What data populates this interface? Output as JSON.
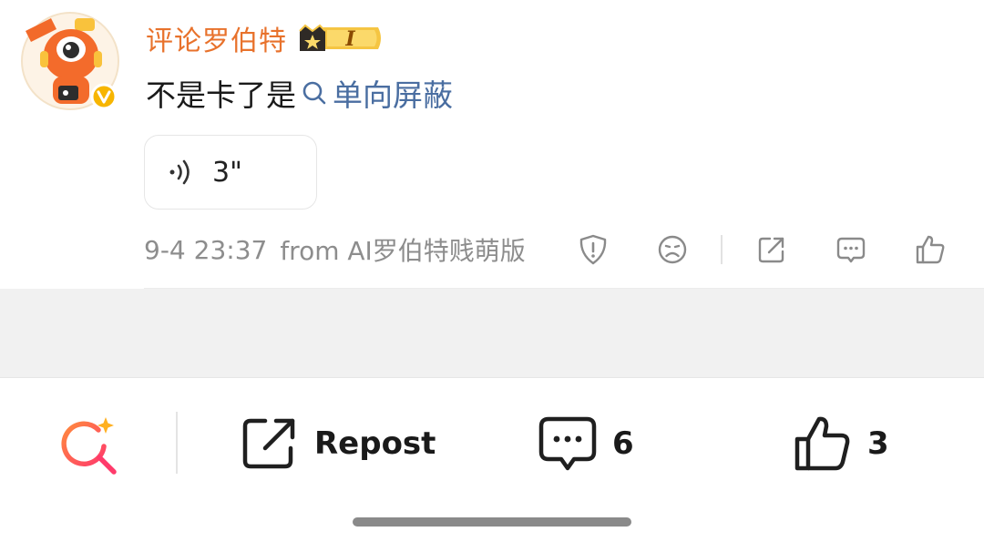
{
  "comment": {
    "username": "评论罗伯特",
    "badge_level": "I",
    "text_prefix": "不是卡了是",
    "link_text": "单向屏蔽",
    "voice_duration": "3\"",
    "timestamp": "9-4 23:37",
    "source": "from AI罗伯特贱萌版",
    "username_color": "#e8722c",
    "link_color": "#4a6ea1"
  },
  "actions": {
    "report_icon": "shield-alert-icon",
    "dislike_icon": "sad-face-icon",
    "repost_icon": "share-icon",
    "comment_icon": "comment-bubble-icon",
    "like_icon": "thumbs-up-icon"
  },
  "bottom_bar": {
    "search_icon": "ai-search-icon",
    "repost_label": "Repost",
    "comment_count": "6",
    "like_count": "3"
  }
}
